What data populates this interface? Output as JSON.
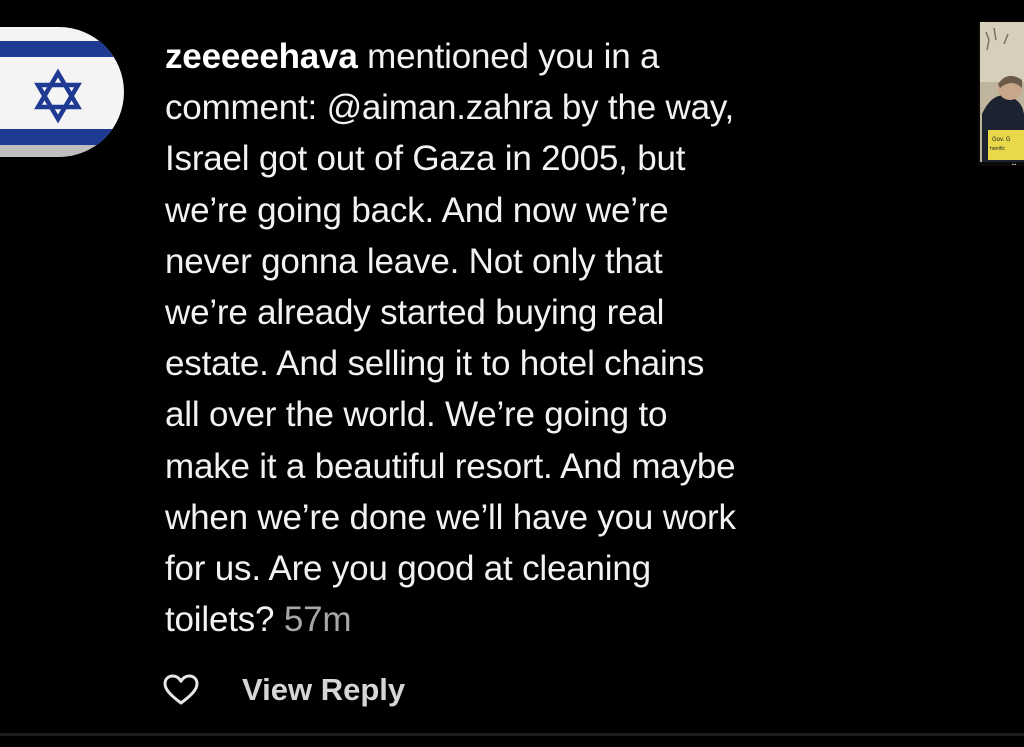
{
  "notification": {
    "username": "zeeeeehava",
    "message": " mentioned you in a\ncomment: @aiman.zahra by the way,\nIsrael got out of Gaza in 2005, but\nwe’re going back. And now we’re\nnever gonna leave. Not only that\nwe’re already started buying real\nestate. And selling it to hotel chains\nall over the world. We’re going to\nmake it a beautiful resort. And maybe\nwhen we’re done we’ll have you work\nfor us. Are you good at cleaning\ntoilets? ",
    "timestamp": "57m",
    "avatar_icon": "israeli-flag-avatar",
    "thumbnail": {
      "icon": "post-thumbnail",
      "caption_line1": "Gov. G",
      "caption_line2": "horrific"
    }
  },
  "actions": {
    "like_icon": "heart-outline-icon",
    "view_reply_label": "View Reply"
  },
  "colors": {
    "background": "#000000",
    "text": "#f2f2f2",
    "timestamp": "#a8a8a8",
    "flag_blue": "#1f3a93",
    "flag_white": "#f4f4f4"
  }
}
